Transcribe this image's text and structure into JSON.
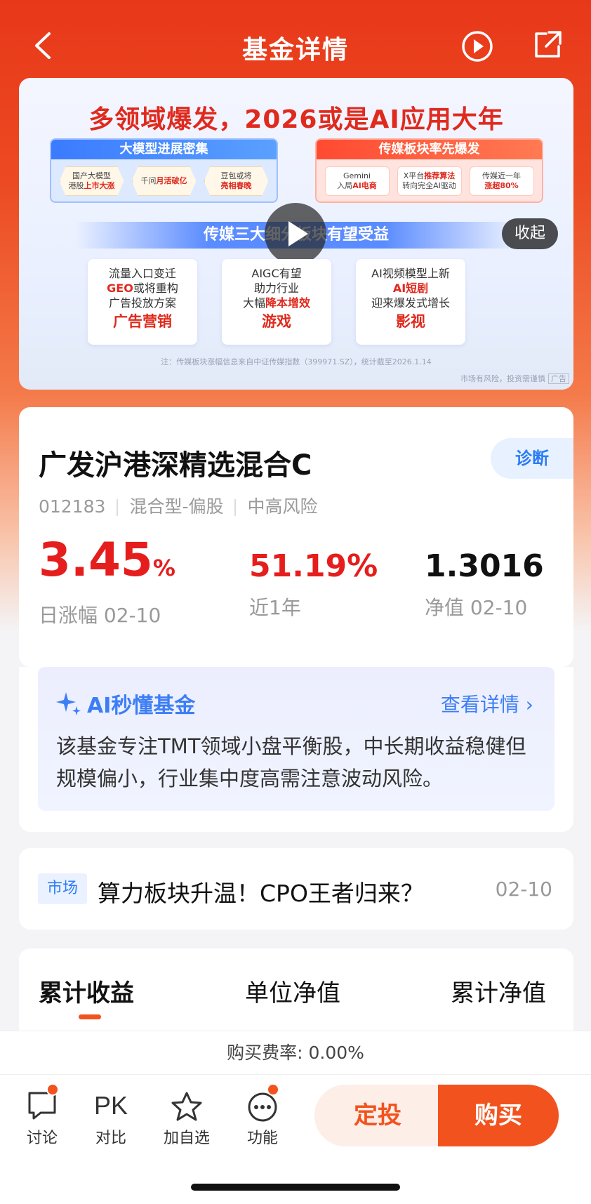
{
  "header": {
    "title": "基金详情"
  },
  "banner": {
    "headline": "多领域爆发，2026或是AI应用大年",
    "left_panel": {
      "title": "大模型进展密集",
      "chips": [
        {
          "pre": "国产大模型",
          "bold": "上市大涨",
          "pre2": "港股"
        },
        {
          "pre": "千问",
          "bold": "月活破亿",
          "pre2": ""
        },
        {
          "pre": "豆包或将",
          "bold": "亮相春晚",
          "pre2": ""
        }
      ]
    },
    "right_panel": {
      "title": "传媒板块率先爆发",
      "chips": [
        {
          "pre": "Gemini",
          "pre2": "入局",
          "bold": "AI电商"
        },
        {
          "pre": "X平台",
          "pre2": "转向完全AI驱动",
          "bold": "推荐算法"
        },
        {
          "pre": "传媒近一年",
          "pre2": "",
          "bold": "涨超80%"
        }
      ]
    },
    "ribbon": "传媒三大细分板块有望受益",
    "collapse": "收起",
    "cards": [
      {
        "line1": "流量入口变迁",
        "bold": "GEO",
        "line2": "或将重构",
        "line3": "广告投放方案",
        "category": "广告营销"
      },
      {
        "line1": "AIGC有望",
        "bold": "降本增效",
        "line2": "助力行业",
        "line3": "大幅",
        "category": "游戏"
      },
      {
        "line1": "AI视频模型上新",
        "bold": "AI短剧",
        "line2": "",
        "line3": "迎来爆发式增长",
        "category": "影视"
      }
    ],
    "note": "注：传媒板块涨幅信息来自中证传媒指数（399971.SZ），统计截至2026.1.14",
    "risk": "市场有风险，投资需谨慎",
    "ad_tag": "广告"
  },
  "fund": {
    "name": "广发沪港深精选混合C",
    "diagnose": "诊断",
    "code": "012183",
    "type": "混合型-偏股",
    "risk": "中高风险",
    "daily_change": "3.45",
    "daily_change_unit": "%",
    "daily_label": "日涨幅 02-10",
    "year_return": "51.19%",
    "year_label": "近1年",
    "nav": "1.3016",
    "nav_label": "净值 02-10"
  },
  "ai": {
    "title": "AI秒懂基金",
    "more": "查看详情 ›",
    "text": "该基金专注TMT领域小盘平衡股，中长期收益稳健但规模偏小，行业集中度高需注意波动风险。"
  },
  "news": {
    "tag": "市场",
    "title": "算力板块升温！CPO王者归来？",
    "date": "02-10"
  },
  "tabs": [
    "累计收益",
    "单位净值",
    "累计净值"
  ],
  "fee": "购买费率: 0.00%",
  "actions": [
    {
      "label": "讨论",
      "icon": "chat-icon"
    },
    {
      "label": "对比",
      "icon": "pk-icon",
      "glyph": "PK"
    },
    {
      "label": "加自选",
      "icon": "star-icon"
    },
    {
      "label": "功能",
      "icon": "more-icon"
    }
  ],
  "buttons": {
    "fixed": "定投",
    "buy": "购买"
  },
  "colors": {
    "accent": "#f2531e",
    "red": "#e61d1d",
    "blue": "#2b7cf5"
  }
}
